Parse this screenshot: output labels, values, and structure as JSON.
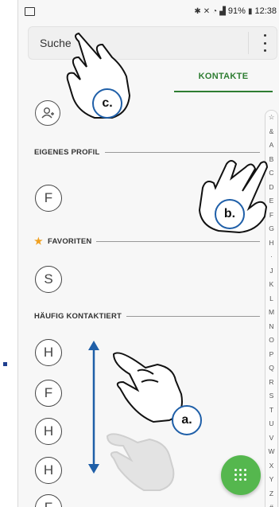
{
  "status_bar": {
    "battery_percent": "91%",
    "time": "12:38"
  },
  "search": {
    "placeholder": "Suche"
  },
  "tabs": {
    "active_label": "KONTAKTE"
  },
  "sections": {
    "own_profile": "EIGENES PROFIL",
    "favorites": "FAVORITEN",
    "frequent": "HÄUFIG KONTAKTIERT"
  },
  "contacts": {
    "own_profile": [
      "F"
    ],
    "favorites": [
      "S"
    ],
    "frequent": [
      "H",
      "F",
      "H",
      "H",
      "F"
    ]
  },
  "index_letters": [
    "☆",
    "&",
    "A",
    "B",
    "C",
    "D",
    "E",
    "F",
    "G",
    "H",
    "·",
    "J",
    "K",
    "L",
    "M",
    "N",
    "O",
    "P",
    "Q",
    "R",
    "S",
    "T",
    "U",
    "V",
    "W",
    "X",
    "Y",
    "Z",
    "#"
  ],
  "gesture_labels": {
    "a": "a.",
    "b": "b.",
    "c": "c."
  },
  "colors": {
    "accent_green": "#2e7d32",
    "fab_green": "#55b74e",
    "favorite_star": "#f0a020",
    "annotation_blue": "#1f5fa8"
  },
  "icons": {
    "add_contact": "add-person-icon",
    "menu": "more-vertical-icon",
    "dialpad": "dialpad-icon"
  }
}
